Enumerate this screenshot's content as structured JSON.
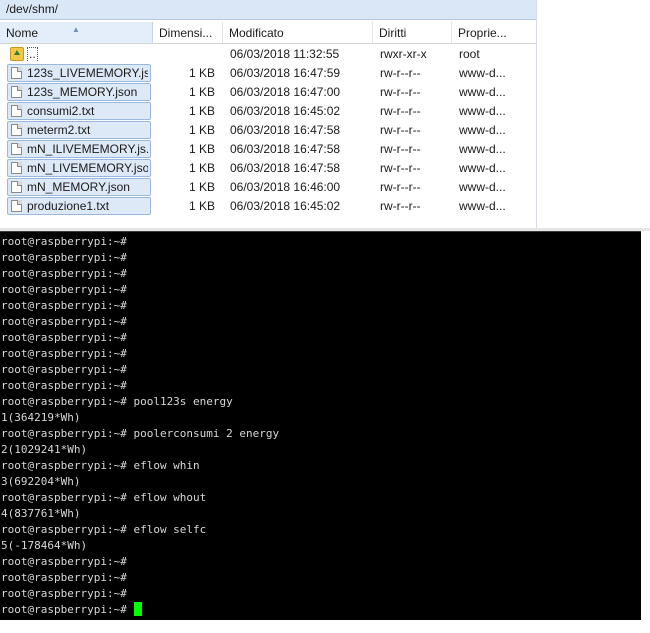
{
  "file_manager": {
    "path": "/dev/shm/",
    "columns": {
      "name": "Nome",
      "size": "Dimensi...",
      "modified": "Modificato",
      "perms": "Diritti",
      "owner": "Proprie..."
    },
    "rows": [
      {
        "name": "..",
        "size": "",
        "modified": "06/03/2018 11:32:55",
        "perms": "rwxr-xr-x",
        "owner": "root",
        "icon": "parent-folder-icon"
      },
      {
        "name": "123s_LIVEMEMORY.js...",
        "size": "1 KB",
        "modified": "06/03/2018 16:47:59",
        "perms": "rw-r--r--",
        "owner": "www-d...",
        "icon": "file-icon"
      },
      {
        "name": "123s_MEMORY.json",
        "size": "1 KB",
        "modified": "06/03/2018 16:47:00",
        "perms": "rw-r--r--",
        "owner": "www-d...",
        "icon": "file-icon"
      },
      {
        "name": "consumi2.txt",
        "size": "1 KB",
        "modified": "06/03/2018 16:45:02",
        "perms": "rw-r--r--",
        "owner": "www-d...",
        "icon": "file-icon"
      },
      {
        "name": "meterm2.txt",
        "size": "1 KB",
        "modified": "06/03/2018 16:47:58",
        "perms": "rw-r--r--",
        "owner": "www-d...",
        "icon": "file-icon"
      },
      {
        "name": "mN_ILIVEMEMORY.js...",
        "size": "1 KB",
        "modified": "06/03/2018 16:47:58",
        "perms": "rw-r--r--",
        "owner": "www-d...",
        "icon": "file-icon"
      },
      {
        "name": "mN_LIVEMEMORY.json",
        "size": "1 KB",
        "modified": "06/03/2018 16:47:58",
        "perms": "rw-r--r--",
        "owner": "www-d...",
        "icon": "file-icon"
      },
      {
        "name": "mN_MEMORY.json",
        "size": "1 KB",
        "modified": "06/03/2018 16:46:00",
        "perms": "rw-r--r--",
        "owner": "www-d...",
        "icon": "file-icon"
      },
      {
        "name": "produzione1.txt",
        "size": "1 KB",
        "modified": "06/03/2018 16:45:02",
        "perms": "rw-r--r--",
        "owner": "www-d...",
        "icon": "file-icon"
      }
    ]
  },
  "terminal": {
    "lines": [
      "root@raspberrypi:~#",
      "root@raspberrypi:~#",
      "root@raspberrypi:~#",
      "root@raspberrypi:~#",
      "root@raspberrypi:~#",
      "root@raspberrypi:~#",
      "root@raspberrypi:~#",
      "root@raspberrypi:~#",
      "root@raspberrypi:~#",
      "root@raspberrypi:~#",
      "root@raspberrypi:~# pool123s energy",
      "1(364219*Wh)",
      "root@raspberrypi:~# poolerconsumi 2 energy",
      "2(1029241*Wh)",
      "root@raspberrypi:~# eflow whin",
      "3(692204*Wh)",
      "root@raspberrypi:~# eflow whout",
      "4(837761*Wh)",
      "root@raspberrypi:~# eflow selfc",
      "5(-178464*Wh)",
      "root@raspberrypi:~#",
      "root@raspberrypi:~#",
      "root@raspberrypi:~#"
    ],
    "prompt": "root@raspberrypi:~# ",
    "cursor_color": "#00ff00"
  }
}
